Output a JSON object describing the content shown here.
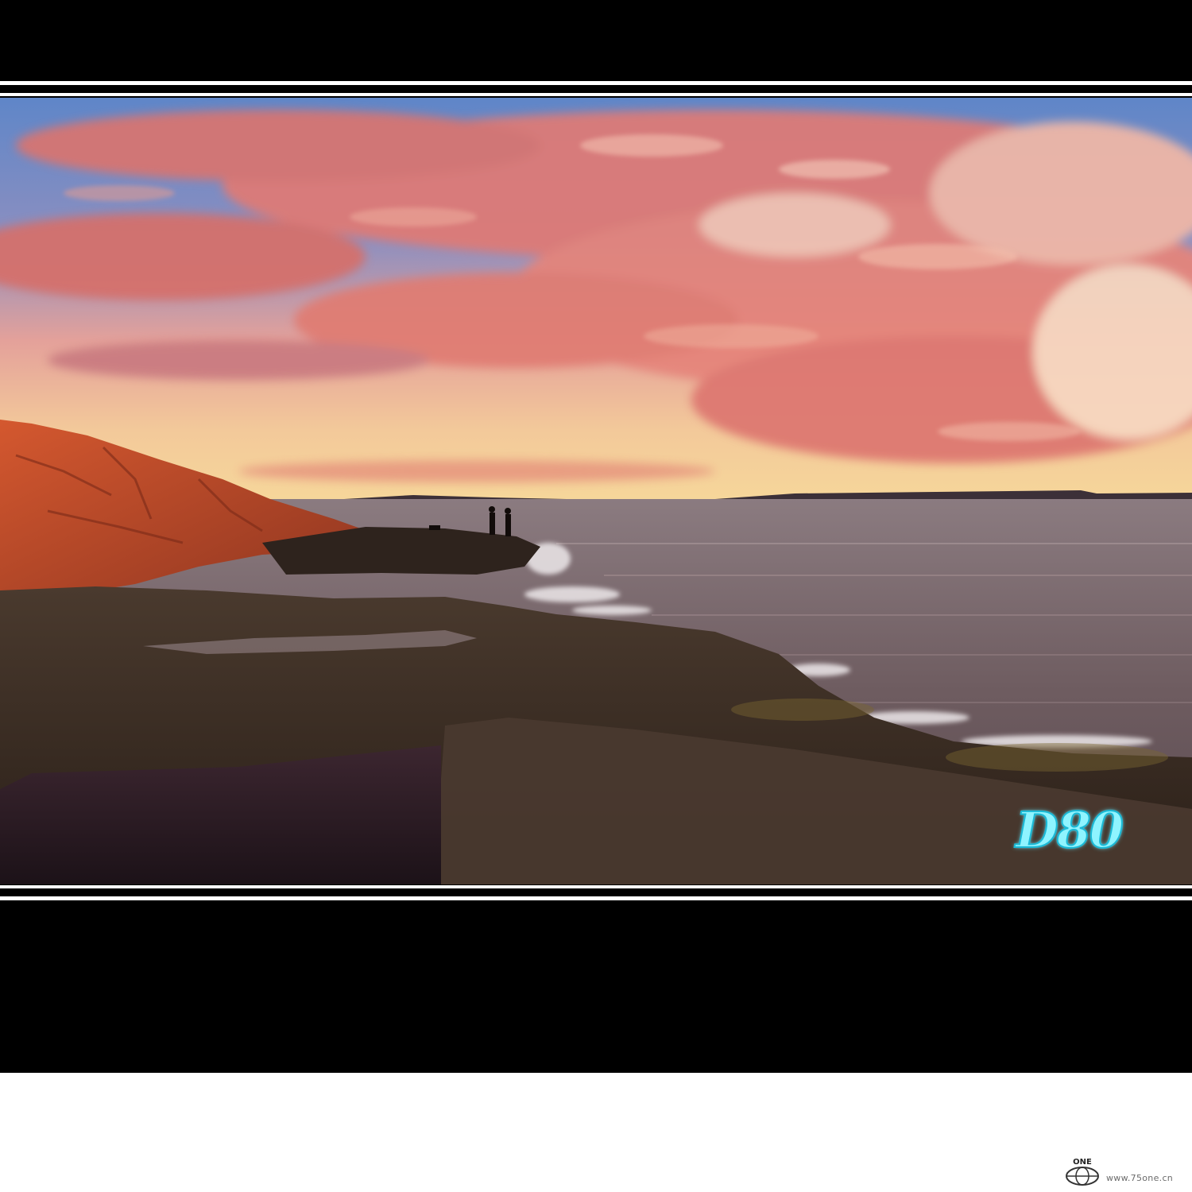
{
  "scene": {
    "description_kind": "photo",
    "colors": {
      "sky_blue": "#5f86c8",
      "cloud_pink": "#e07a74",
      "horizon_glow": "#f6d79a",
      "sea": "#6e5c60",
      "rock_lit": "#c9502d",
      "rock_dark": "#3a2c22",
      "frame": "#000000"
    }
  },
  "watermark": {
    "camera_label": "D80",
    "color": "#8ff4ff"
  },
  "footer": {
    "logo_text": "ONE",
    "site_url": "www.75one.cn"
  }
}
